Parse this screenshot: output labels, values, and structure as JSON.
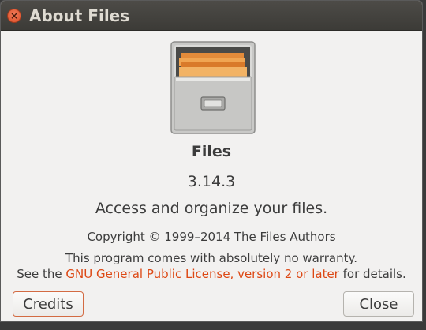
{
  "window": {
    "title": "About Files"
  },
  "icons": {
    "close": "close-icon",
    "app": "file-cabinet-icon"
  },
  "about": {
    "app_name": "Files",
    "version": "3.14.3",
    "comment": "Access and organize your files.",
    "copyright": "Copyright © 1999–2014 The Files Authors",
    "warranty_line1": "This program comes with absolutely no warranty.",
    "warranty_prefix": "See the ",
    "license_link": "GNU General Public License, version 2 or later",
    "warranty_suffix": " for details."
  },
  "buttons": {
    "credits": "Credits",
    "close": "Close"
  },
  "colors": {
    "link": "#dd4814",
    "titlebar": "#3c3b37",
    "close_button": "#d94c26",
    "dialog_bg": "#f2f1f0"
  }
}
